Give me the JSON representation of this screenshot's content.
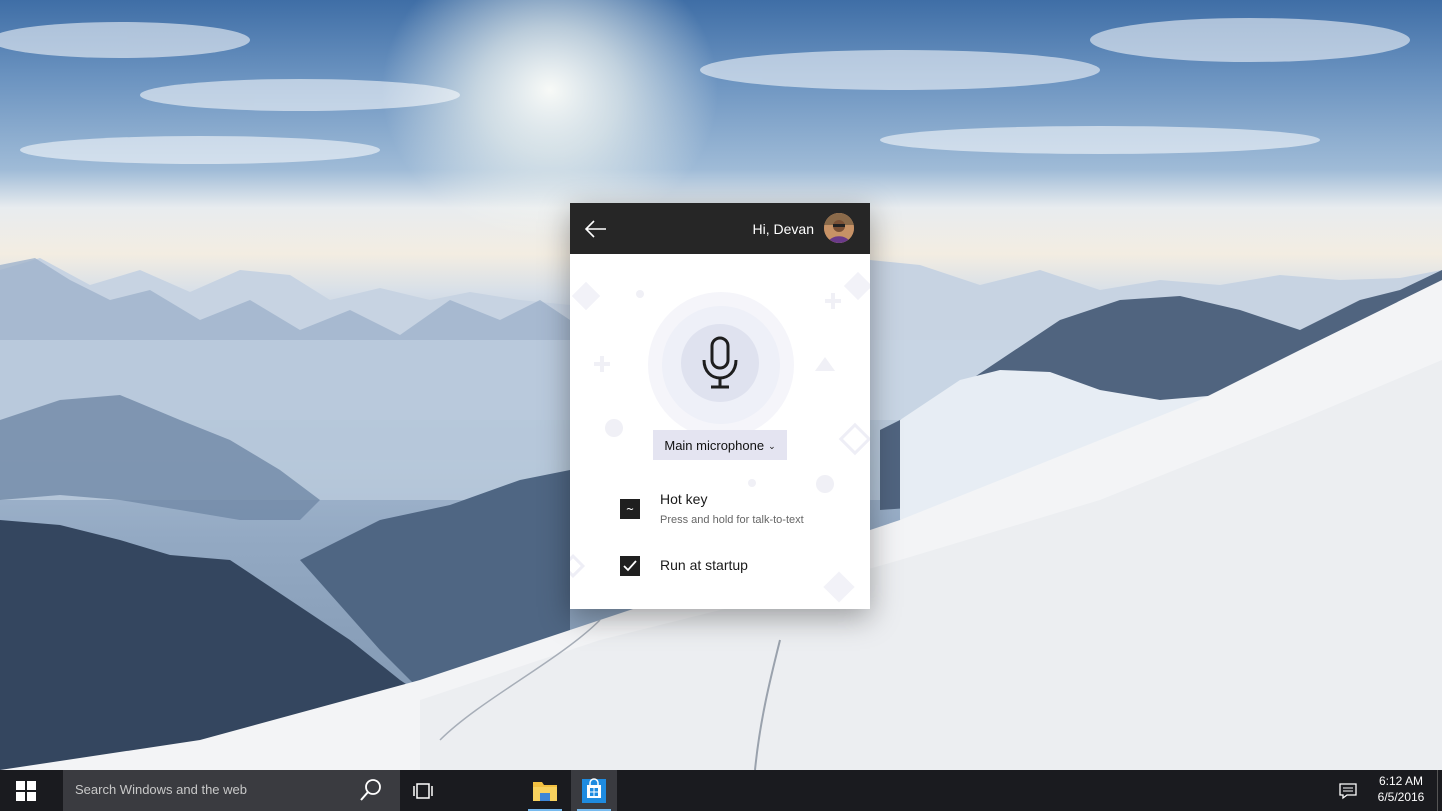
{
  "window": {
    "greeting": "Hi, Devan",
    "microphone_select": "Main microphone",
    "hotkey": {
      "key": "~",
      "title": "Hot key",
      "subtitle": "Press and hold for talk-to-text"
    },
    "run_at_startup": {
      "label": "Run at startup",
      "checked": true
    },
    "accent_color": "#262626"
  },
  "taskbar": {
    "search_placeholder": "Search Windows and the web",
    "clock_time": "6:12 AM",
    "clock_date": "6/5/2016",
    "apps": [
      "file-explorer",
      "store"
    ]
  }
}
